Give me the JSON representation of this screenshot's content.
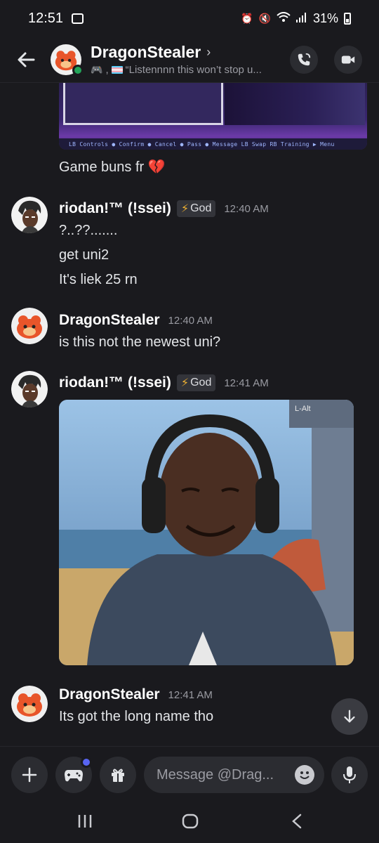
{
  "status_bar": {
    "time": "12:51",
    "battery": "31%"
  },
  "header": {
    "name": "DragonStealer",
    "chevron": "›",
    "status_text": "“Listennnn this won’t stop u..."
  },
  "embed": {
    "controls_text": "LB Controls  ● Confirm  ● Cancel  ● Pass  ● Message  LB Swap  RB Training  ▶ Menu"
  },
  "messages": {
    "m0": {
      "line1": "Game buns fr",
      "emoji": "💔"
    },
    "m1": {
      "username": "riodan!™ (!ssei)",
      "badge": "God",
      "time": "12:40 AM",
      "lines": [
        "?..??.......",
        "get uni2",
        "It's liek 25 rn"
      ]
    },
    "m2": {
      "username": "DragonStealer",
      "time": "12:40 AM",
      "lines": [
        "is this not the newest uni?"
      ]
    },
    "m3": {
      "username": "riodan!™ (!ssei)",
      "badge": "God",
      "time": "12:41 AM",
      "photo_overlay": "L-Alt"
    },
    "m4": {
      "username": "DragonStealer",
      "time": "12:41 AM",
      "lines": [
        "Its got the long name tho"
      ]
    }
  },
  "composer": {
    "placeholder": "Message @Drag..."
  },
  "colors": {
    "accent": "#5865f2",
    "online": "#23a55a",
    "background": "#1a1a1e",
    "badge_bolt": "#f0b232"
  }
}
